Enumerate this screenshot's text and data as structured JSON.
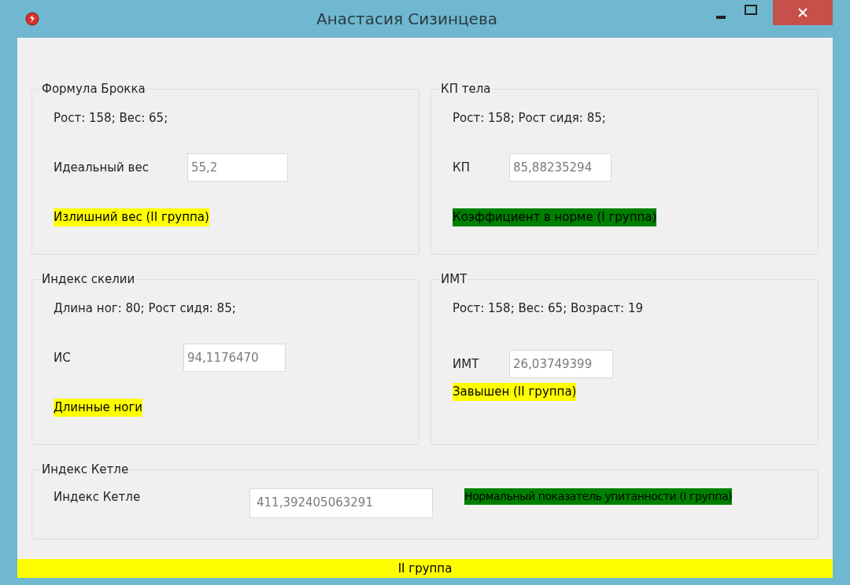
{
  "window": {
    "title": "Анастасия Сизинцева"
  },
  "groups": [
    {
      "title": "Формула Брокка",
      "info": "Рост: 158; Вес: 65;",
      "field": {
        "label": "Идеальный вес",
        "value": "55,2"
      },
      "result": {
        "text": "Излишний вес (II группа)",
        "color": "#ffff00"
      }
    },
    {
      "title": "КП тела",
      "info": "Рост: 158; Рост сидя: 85;",
      "field": {
        "label": "КП",
        "value": "85,88235294"
      },
      "result": {
        "text": "Коэффициент в норме (I группа)",
        "color": "#008000"
      }
    },
    {
      "title": "Индекс скелии",
      "info": "Длина ног: 80; Рост сидя: 85;",
      "field": {
        "label": "ИС",
        "value": "94,1176470"
      },
      "result": {
        "text": "Длинные ноги",
        "color": "#ffff00"
      }
    },
    {
      "title": "ИМТ",
      "info": "Рост: 158; Вес: 65; Возраст: 19",
      "field": {
        "label": "ИМТ",
        "value": "26,03749399"
      },
      "result": {
        "text": "Завышен (II группа)",
        "color": "#ffff00"
      }
    }
  ],
  "bottom_group": {
    "title": "Индекс Кетле",
    "field": {
      "label": "Индекс Кетле",
      "value": "411,392405063291"
    },
    "result": {
      "text": "Нормальный показатель упитанности (I группа)",
      "color": "#008000"
    }
  },
  "status_bar": {
    "text": "II группа",
    "color": "#ffff00"
  }
}
